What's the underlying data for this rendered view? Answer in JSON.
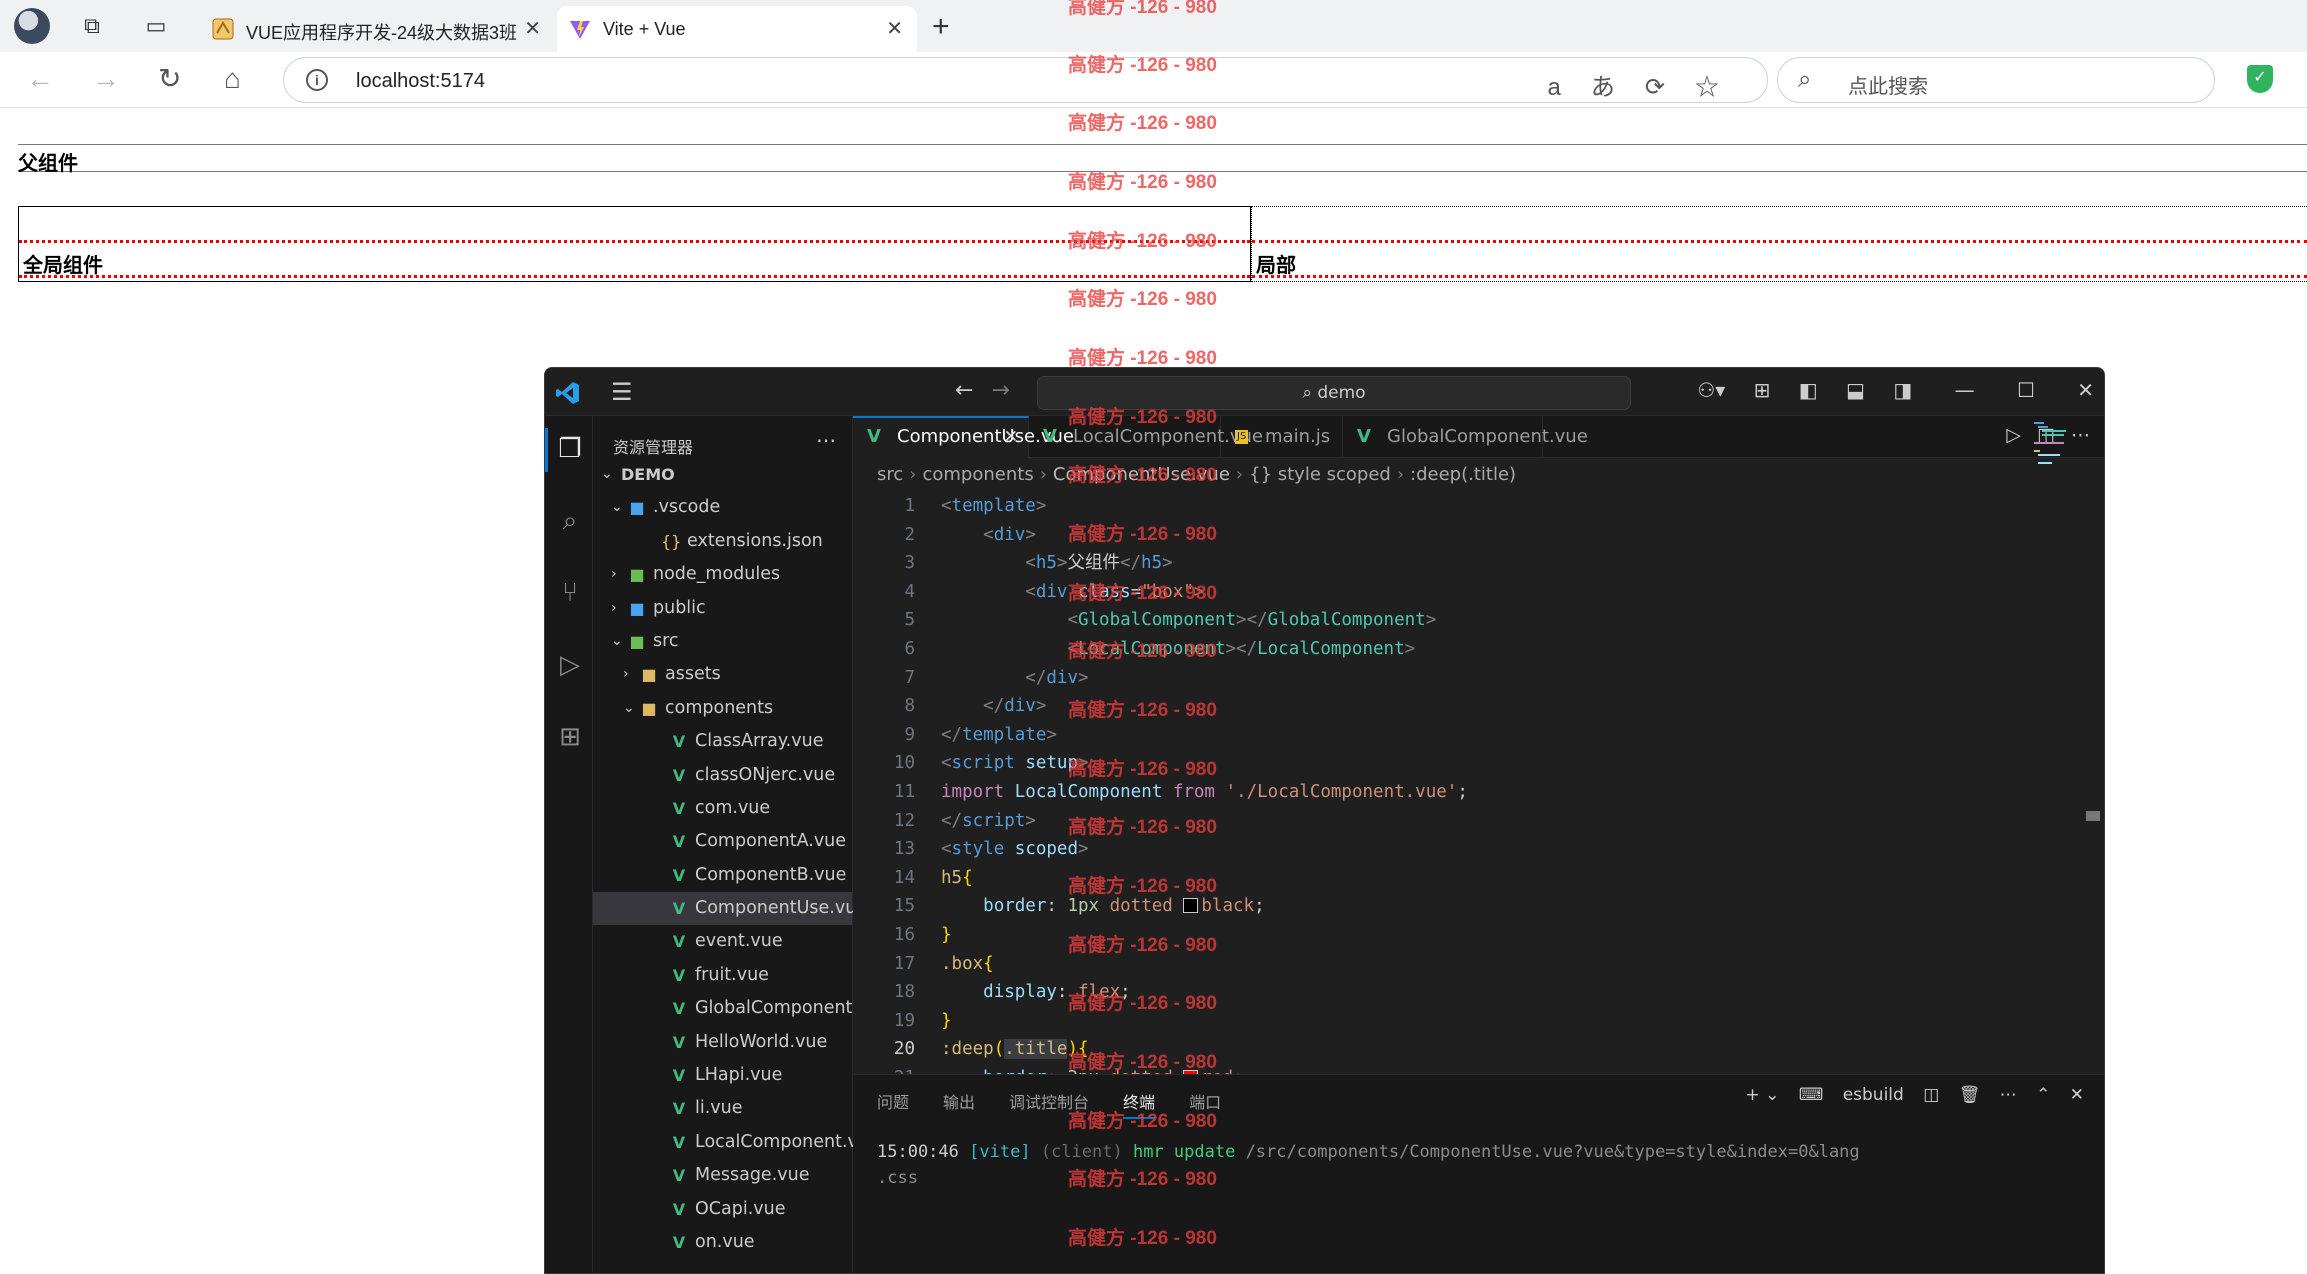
{
  "browser": {
    "tabs": [
      {
        "title": "VUE应用程序开发-24级大数据3班",
        "active": false
      },
      {
        "title": "Vite + Vue",
        "active": true
      }
    ],
    "url": "localhost:5174",
    "search_placeholder": "点此搜索",
    "translate_glyph": "aあ"
  },
  "page": {
    "parent_heading": "父组件",
    "global_component_title": "全局组件",
    "local_component_title": "局部"
  },
  "watermark": {
    "text": "高健方 -126 - 980"
  },
  "vscode": {
    "command_center": "demo",
    "explorer_title": "资源管理器",
    "explorer_root": "DEMO",
    "tree": [
      {
        "label": ".vscode",
        "type": "folder-blue",
        "open": true,
        "depth": 1
      },
      {
        "label": "extensions.json",
        "type": "json",
        "depth": 2
      },
      {
        "label": "node_modules",
        "type": "folder-green",
        "open": false,
        "depth": 1
      },
      {
        "label": "public",
        "type": "folder-blue",
        "open": false,
        "depth": 1
      },
      {
        "label": "src",
        "type": "folder-green",
        "open": true,
        "depth": 1
      },
      {
        "label": "assets",
        "type": "folder",
        "open": false,
        "depth": 2
      },
      {
        "label": "components",
        "type": "folder",
        "open": true,
        "depth": 2
      },
      {
        "label": "ClassArray.vue",
        "type": "vue",
        "depth": 3
      },
      {
        "label": "classONjerc.vue",
        "type": "vue",
        "depth": 3
      },
      {
        "label": "com.vue",
        "type": "vue",
        "depth": 3
      },
      {
        "label": "ComponentA.vue",
        "type": "vue",
        "depth": 3
      },
      {
        "label": "ComponentB.vue",
        "type": "vue",
        "depth": 3
      },
      {
        "label": "ComponentUse.vue",
        "type": "vue",
        "depth": 3,
        "selected": true
      },
      {
        "label": "event.vue",
        "type": "vue",
        "depth": 3
      },
      {
        "label": "fruit.vue",
        "type": "vue",
        "depth": 3
      },
      {
        "label": "GlobalComponent.vue",
        "type": "vue",
        "depth": 3
      },
      {
        "label": "HelloWorld.vue",
        "type": "vue",
        "depth": 3
      },
      {
        "label": "LHapi.vue",
        "type": "vue",
        "depth": 3
      },
      {
        "label": "li.vue",
        "type": "vue",
        "depth": 3
      },
      {
        "label": "LocalComponent.vue",
        "type": "vue",
        "depth": 3
      },
      {
        "label": "Message.vue",
        "type": "vue",
        "depth": 3
      },
      {
        "label": "OCapi.vue",
        "type": "vue",
        "depth": 3
      },
      {
        "label": "on.vue",
        "type": "vue",
        "depth": 3
      }
    ],
    "editor_tabs": [
      {
        "label": "ComponentUse.vue",
        "icon": "vue",
        "active": true
      },
      {
        "label": "LocalComponent.vue",
        "icon": "vue",
        "active": false
      },
      {
        "label": "main.js",
        "icon": "js",
        "active": false
      },
      {
        "label": "GlobalComponent.vue",
        "icon": "vue",
        "active": false
      }
    ],
    "breadcrumb": [
      "src",
      "components",
      "ComponentUse.vue",
      "{} style scoped",
      ":deep(.title)"
    ],
    "current_line": 20,
    "panel_tabs": [
      "问题",
      "输出",
      "调试控制台",
      "终端",
      "端口"
    ],
    "panel_active": "终端",
    "terminal_profile": "esbuild",
    "terminal": {
      "time": "15:00:46",
      "tag": "[vite]",
      "source": "(client)",
      "action": "hmr update",
      "path": "/src/components/ComponentUse.vue?vue&type=style&index=0&lang",
      "cont": ".css"
    }
  }
}
